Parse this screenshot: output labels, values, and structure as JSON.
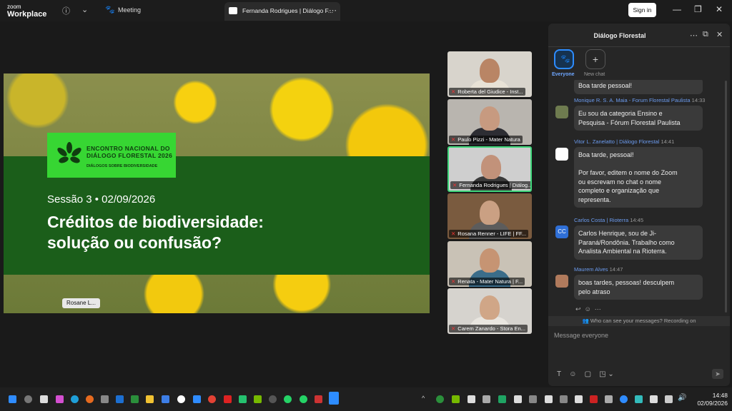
{
  "app": {
    "logo_line1": "zoom",
    "logo_line2": "Workplace",
    "meeting_label": "Meeting",
    "tab_title": "Fernanda Rodrigues | Diálogo F...",
    "signin_label": "Sign in"
  },
  "slide": {
    "logo_title_line1": "ENCONTRO NACIONAL DO",
    "logo_title_line2": "DIÁLOGO FLORESTAL 2026",
    "logo_subtitle": "DIÁLOGOS SOBRE BIODIVERSIDADE",
    "session": "Sessão 3 • 02/09/2026",
    "headline_line1": "Créditos de biodiversidade:",
    "headline_line2": "solução ou confusão?",
    "presenter_chip": "Rosane L..."
  },
  "participants": [
    {
      "name": "Roberta del Giudice - Inst..."
    },
    {
      "name": "Paulo Pizzi - Mater Natura"
    },
    {
      "name": "Fernanda Rodrigues | Diálog..."
    },
    {
      "name": "Rosana Renner - LIFE | FF..."
    },
    {
      "name": "Renata - Mater Natura | F..."
    },
    {
      "name": "Carem Zanardo - Stora En..."
    }
  ],
  "chat": {
    "title": "Diálogo Florestal",
    "tabs": [
      {
        "label": "Everyone"
      },
      {
        "label": "New chat"
      }
    ],
    "prev_bubble": "Boa tarde pessoal!",
    "messages": [
      {
        "sender": "Monique R. S. A. Maia - Forum Florestal Paulista",
        "time": "14:33",
        "lines": [
          "Eu sou da categoria Ensino e",
          "Pesquisa - Fórum Florestal Paulista"
        ]
      },
      {
        "sender": "Vitor L. Zanelatto | Diálogo Florestal",
        "time": "14:41",
        "lines": [
          "Boa tarde, pessoal!",
          "",
          "Por favor, editem o nome do Zoom",
          "ou escrevam no chat o nome",
          "completo e organização que",
          "representa."
        ]
      },
      {
        "sender": "Carlos Costa | Rioterra",
        "time": "14:45",
        "avatar": "CC",
        "lines": [
          "Carlos Henrique, sou de Ji-",
          "Paraná/Rondônia. Trabalho como",
          "Analista Ambiental na Rioterra."
        ]
      },
      {
        "sender": "Maurem Alves",
        "time": "14:47",
        "lines": [
          "boas tardes, pessoas! desculpem",
          "pelo atraso"
        ]
      }
    ],
    "notice": "Who can see your messages? Recording on",
    "input_placeholder": "Message everyone"
  },
  "taskbar": {
    "time": "14:48",
    "date": "02/09/2026"
  },
  "colors": {
    "accent": "#2d8cff",
    "slide_green": "#1b5e1a",
    "logo_green": "#37d633"
  }
}
